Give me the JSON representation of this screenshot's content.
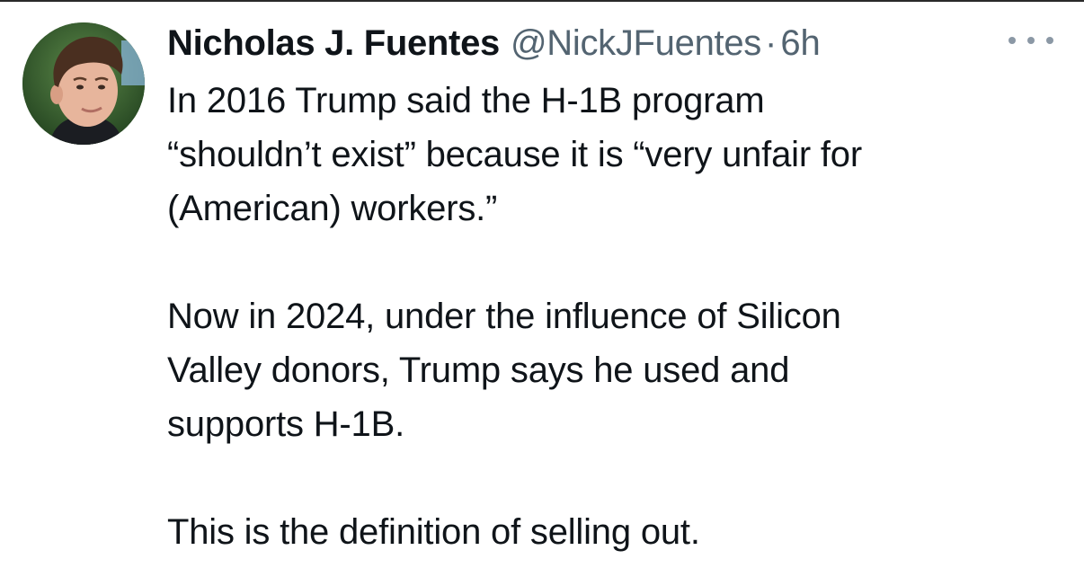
{
  "tweet": {
    "author": {
      "display_name": "Nicholas J. Fuentes",
      "handle": "@NickJFuentes",
      "separator": "·",
      "time": "6h",
      "avatar_icon": "profile-photo"
    },
    "more_icon": "more-dots-icon",
    "body": {
      "paragraph_1": [
        "In 2016 Trump said the H-1B program",
        "“shouldn’t exist” because it is “very unfair for",
        "(American) workers.”"
      ],
      "paragraph_2": [
        "Now in 2024, under the influence of Silicon",
        "Valley donors, Trump says he used and",
        "supports H-1B."
      ],
      "paragraph_3": [
        "This is the definition of selling out."
      ]
    }
  },
  "colors": {
    "text_primary": "#0f1419",
    "text_secondary": "#536471",
    "background": "#ffffff"
  }
}
